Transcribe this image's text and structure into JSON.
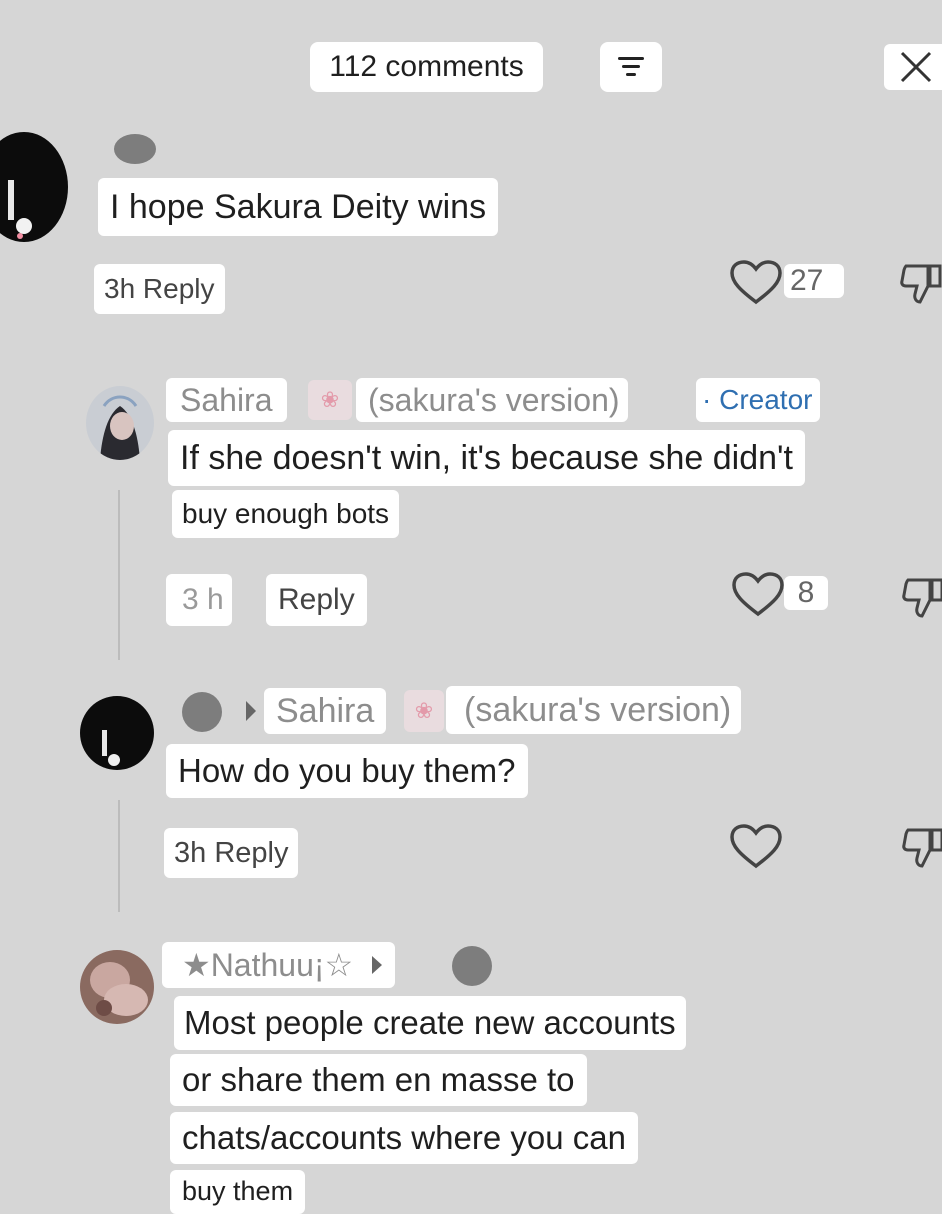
{
  "header": {
    "comments_count": "112 comments"
  },
  "comments": [
    {
      "text": "I hope Sakura Deity wins",
      "meta": "3h Reply",
      "likes": "27"
    },
    {
      "author": "Sahira",
      "author_suffix": "(sakura's version)",
      "badge": "· Creator",
      "text_line1": "If she doesn't win, it's because she didn't",
      "text_line2": "buy enough bots",
      "time": "3 h",
      "reply": "Reply",
      "likes": "8"
    },
    {
      "reply_to": "Sahira",
      "reply_to_suffix": "(sakura's version)",
      "text": "How do you buy them?",
      "meta": "3h Reply"
    },
    {
      "author": "★Nathuu¡☆",
      "lines": [
        "Most people create new accounts",
        "or share them en masse to",
        "chats/accounts where you can",
        "buy them"
      ]
    }
  ]
}
